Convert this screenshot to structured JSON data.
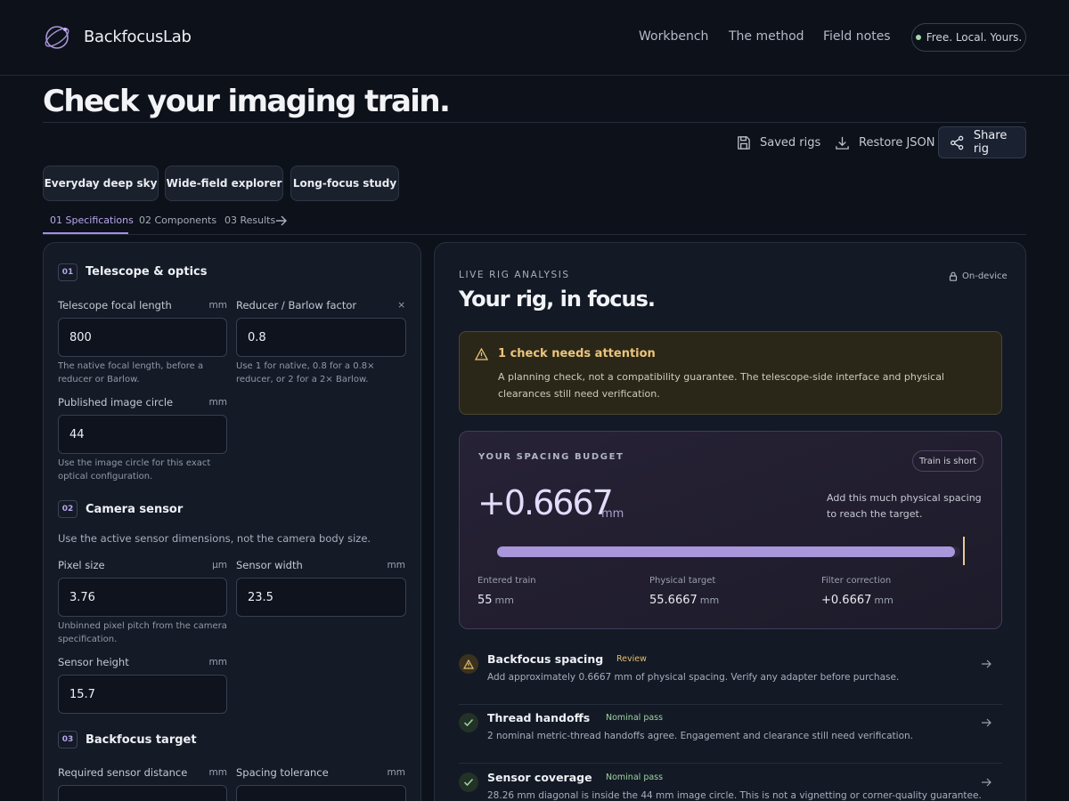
{
  "header": {
    "brand": "BackfocusLab",
    "logo_icon": "orbit-lens-icon",
    "nav": [
      "Workbench",
      "The method",
      "Field notes"
    ],
    "badge": "Free. Local. Yours."
  },
  "page": {
    "title": "Check your imaging train.",
    "actions": {
      "saved": "Saved rigs",
      "restore": "Restore JSON",
      "share": "Share rig"
    },
    "presets": [
      "Everyday deep sky",
      "Wide-field explorer",
      "Long-focus study"
    ],
    "tabs": [
      "01 Specifications",
      "02 Components",
      "03 Results"
    ],
    "active_tab": "01 Specifications"
  },
  "spec": {
    "telescope": {
      "num": "01",
      "title": "Telescope & optics",
      "focal_label": "Telescope focal length",
      "focal_unit": "mm",
      "focal_value": "800",
      "focal_hint": "The native focal length, before a reducer or Barlow.",
      "reducer_label": "Reducer / Barlow factor",
      "reducer_unit": "×",
      "reducer_value": "0.8",
      "reducer_hint": "Use 1 for native, 0.8 for a 0.8× reducer, or 2 for a 2× Barlow.",
      "circle_label": "Published image circle",
      "circle_unit": "mm",
      "circle_value": "44",
      "circle_hint": "Use the image circle for this exact optical configuration."
    },
    "camera": {
      "num": "02",
      "title": "Camera sensor",
      "desc": "Use the active sensor dimensions, not the camera body size.",
      "pixel_label": "Pixel size",
      "pixel_unit": "μm",
      "pixel_value": "3.76",
      "pixel_hint": "Unbinned pixel pitch from the camera specification.",
      "width_label": "Sensor width",
      "width_unit": "mm",
      "width_value": "23.5",
      "height_label": "Sensor height",
      "height_unit": "mm",
      "height_value": "15.7"
    },
    "backfocus": {
      "num": "03",
      "title": "Backfocus target",
      "distance_label": "Required sensor distance",
      "distance_unit": "mm",
      "tolerance_label": "Spacing tolerance",
      "tolerance_unit": "mm"
    }
  },
  "analysis": {
    "eyebrow": "LIVE RIG ANALYSIS",
    "on_device": "On-device",
    "title": "Your rig, in focus.",
    "alert": {
      "title": "1 check needs attention",
      "body": "A planning check, not a compatibility guarantee. The telescope-side interface and physical clearances still need verification."
    },
    "budget": {
      "eyebrow": "YOUR SPACING BUDGET",
      "status": "Train is short",
      "value": "+0.6667",
      "unit": "mm",
      "desc": "Add this much physical spacing to reach the target.",
      "progress_fraction": 0.988,
      "stats": [
        {
          "label": "Entered train",
          "value": "55",
          "unit": "mm"
        },
        {
          "label": "Physical target",
          "value": "55.6667",
          "unit": "mm"
        },
        {
          "label": "Filter correction",
          "value": "+0.6667",
          "unit": "mm"
        }
      ]
    },
    "checks": [
      {
        "title": "Backfocus spacing",
        "tag": "Review",
        "status": "warn",
        "desc": "Add approximately 0.6667 mm of physical spacing. Verify any adapter before purchase."
      },
      {
        "title": "Thread handoffs",
        "tag": "Nominal pass",
        "status": "ok",
        "desc": "2 nominal metric-thread handoffs agree. Engagement and clearance still need verification."
      },
      {
        "title": "Sensor coverage",
        "tag": "Nominal pass",
        "status": "ok",
        "desc": "28.26 mm diagonal is inside the 44 mm image circle. This is not a vignetting or corner-quality guarantee."
      }
    ]
  },
  "colors": {
    "accent": "#a48fe4",
    "warning": "#ecc57b",
    "success": "#9fd3a2",
    "background": "#0d1119"
  }
}
